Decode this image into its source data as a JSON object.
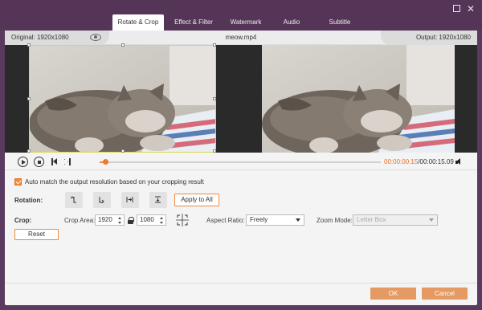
{
  "window": {
    "maximize_icon": "maximize-icon",
    "close_icon": "close-icon",
    "close_glyph": "✕"
  },
  "tabs": [
    {
      "label": "Rotate & Crop",
      "active": true
    },
    {
      "label": "Effect & Filter",
      "active": false
    },
    {
      "label": "Watermark",
      "active": false
    },
    {
      "label": "Audio",
      "active": false
    },
    {
      "label": "Subtitle",
      "active": false
    }
  ],
  "info": {
    "original": "Original: 1920x1080",
    "filename": "meow.mp4",
    "output": "Output: 1920x1080"
  },
  "player": {
    "progress_fraction": 0.02,
    "current_time": "00:00:00.15",
    "separator": "/",
    "duration": "00:00:15.09"
  },
  "options": {
    "auto_match_label": "Auto match the output resolution based on your cropping result",
    "auto_match_checked": true
  },
  "rotation": {
    "label": "Rotation:",
    "apply_all_label": "Apply to All"
  },
  "crop": {
    "label": "Crop:",
    "area_label": "Crop Area:",
    "width": "1920",
    "height": "1080",
    "aspect_label": "Aspect Ratio:",
    "aspect_value": "Freely",
    "zoom_label": "Zoom Mode:",
    "zoom_value": "Letter Box",
    "reset_label": "Reset"
  },
  "footer": {
    "ok_label": "OK",
    "cancel_label": "Cancel"
  },
  "colors": {
    "window_bg": "#553557",
    "accent": "#f08a3c",
    "button_fill": "#e59a63"
  }
}
